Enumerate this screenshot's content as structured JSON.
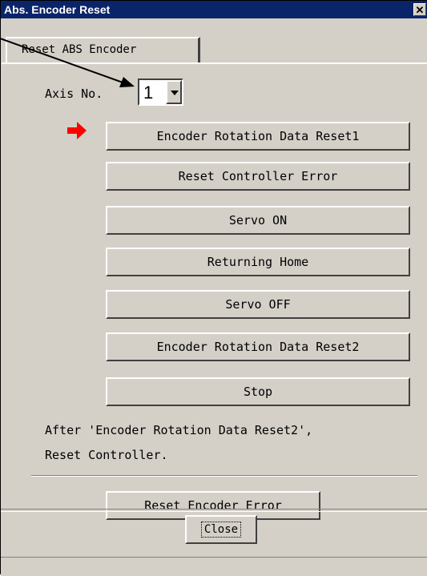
{
  "window": {
    "title": "Abs. Encoder Reset",
    "close_glyph": "✕",
    "titlebar_color": "#0a246a"
  },
  "tab": {
    "label": "Reset ABS Encoder"
  },
  "axis": {
    "label": "Axis No.",
    "value": "1"
  },
  "buttons": {
    "encoder_reset1": "Encoder Rotation Data Reset1",
    "reset_controller_error": "Reset Controller Error",
    "servo_on": "Servo ON",
    "returning_home": "Returning Home",
    "servo_off": "Servo OFF",
    "encoder_reset2": "Encoder Rotation Data Reset2",
    "stop": "Stop",
    "reset_encoder_error": "Reset Encoder Error",
    "close": "Close"
  },
  "note": {
    "line1": "After 'Encoder Rotation Data Reset2',",
    "line2": "Reset Controller."
  },
  "indicator": {
    "icon": "red-arrow-icon",
    "color": "#ff0000"
  }
}
